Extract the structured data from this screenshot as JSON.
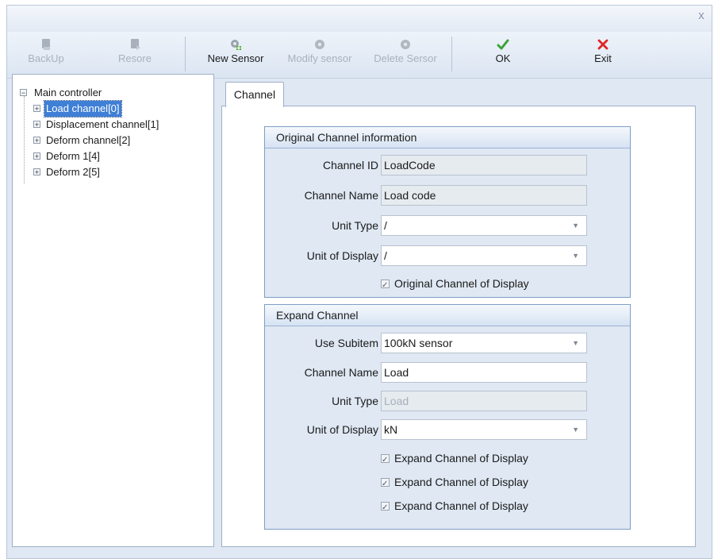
{
  "window": {
    "close_symbol": "x"
  },
  "toolbar": {
    "buttons": [
      {
        "label": "BackUp",
        "icon": "backup-icon",
        "enabled": false
      },
      {
        "label": "Resore",
        "icon": "restore-icon",
        "enabled": false
      },
      {
        "label": "New Sensor",
        "icon": "new-sensor-icon",
        "enabled": true
      },
      {
        "label": "Modify sensor",
        "icon": "modify-sensor-icon",
        "enabled": false
      },
      {
        "label": "Delete Sersor",
        "icon": "delete-sensor-icon",
        "enabled": false
      },
      {
        "label": "OK",
        "icon": "check-icon",
        "enabled": true
      },
      {
        "label": "Exit",
        "icon": "close-icon",
        "enabled": true
      }
    ]
  },
  "tree": {
    "root": "Main controller",
    "items": [
      {
        "label": "Load channel[0]",
        "selected": true
      },
      {
        "label": "Displacement channel[1]",
        "selected": false
      },
      {
        "label": "Deform channel[2]",
        "selected": false
      },
      {
        "label": "Deform 1[4]",
        "selected": false
      },
      {
        "label": "Deform 2[5]",
        "selected": false
      }
    ]
  },
  "tab": {
    "label": "Channel"
  },
  "original": {
    "title": "Original Channel information",
    "channel_id_label": "Channel ID",
    "channel_id_value": "LoadCode",
    "channel_name_label": "Channel Name",
    "channel_name_value": "Load code",
    "unit_type_label": "Unit Type",
    "unit_type_value": "/",
    "unit_display_label": "Unit of Display",
    "unit_display_value": "/",
    "display_checkbox": "Original Channel of Display"
  },
  "expand": {
    "title": "Expand Channel",
    "use_subitem_label": "Use Subitem",
    "use_subitem_value": "100kN sensor",
    "channel_name_label": "Channel Name",
    "channel_name_value": "Load",
    "unit_type_label": "Unit Type",
    "unit_type_value": "Load",
    "unit_display_label": "Unit of Display",
    "unit_display_value": "kN",
    "checkboxes": [
      "Expand Channel of Display",
      "Expand Channel of Display",
      "Expand Channel of Display"
    ]
  },
  "colors": {
    "selection": "#3f7fd6",
    "ok_green": "#3aa23a",
    "exit_red": "#e02525"
  }
}
